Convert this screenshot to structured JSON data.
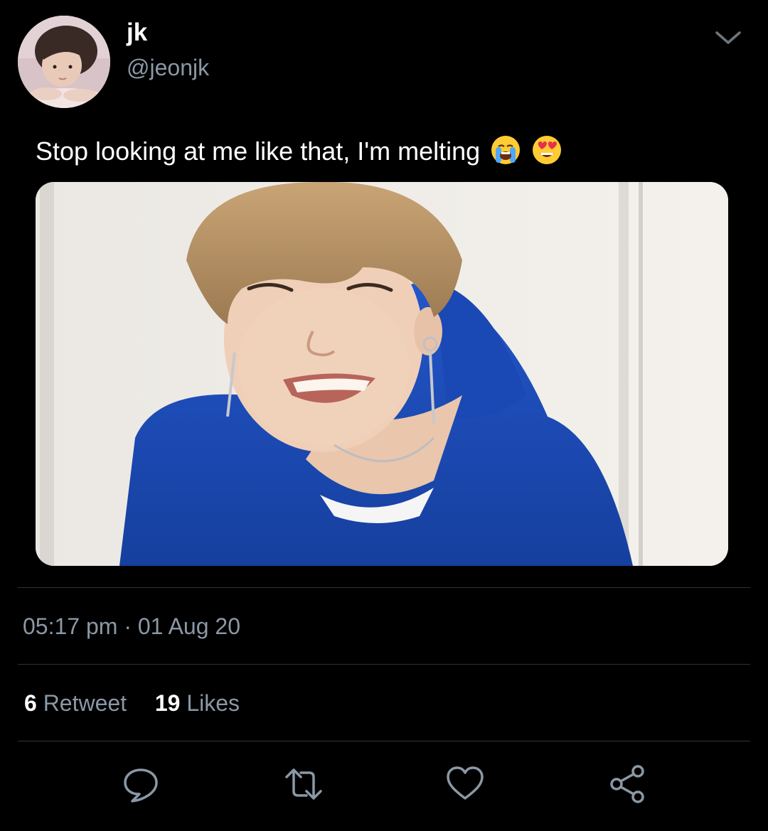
{
  "user": {
    "display_name": "jk",
    "handle": "@jeonjk"
  },
  "tweet": {
    "text": "Stop looking at me like that, I'm melting",
    "emojis": [
      "loudly-crying-face",
      "smiling-face-with-heart-eyes"
    ]
  },
  "meta": {
    "timestamp": "05:17 pm · 01 Aug 20"
  },
  "stats": {
    "retweet_count": "6",
    "retweet_label": "Retweet",
    "likes_count": "19",
    "likes_label": "Likes"
  },
  "actions": [
    "reply-icon",
    "retweet-icon",
    "like-icon",
    "share-icon"
  ],
  "colors": {
    "background": "#000000",
    "primary_text": "#ffffff",
    "secondary_text": "#8b98a5",
    "divider": "#2f3336",
    "hoodie_blue": "#1f4fc0"
  }
}
